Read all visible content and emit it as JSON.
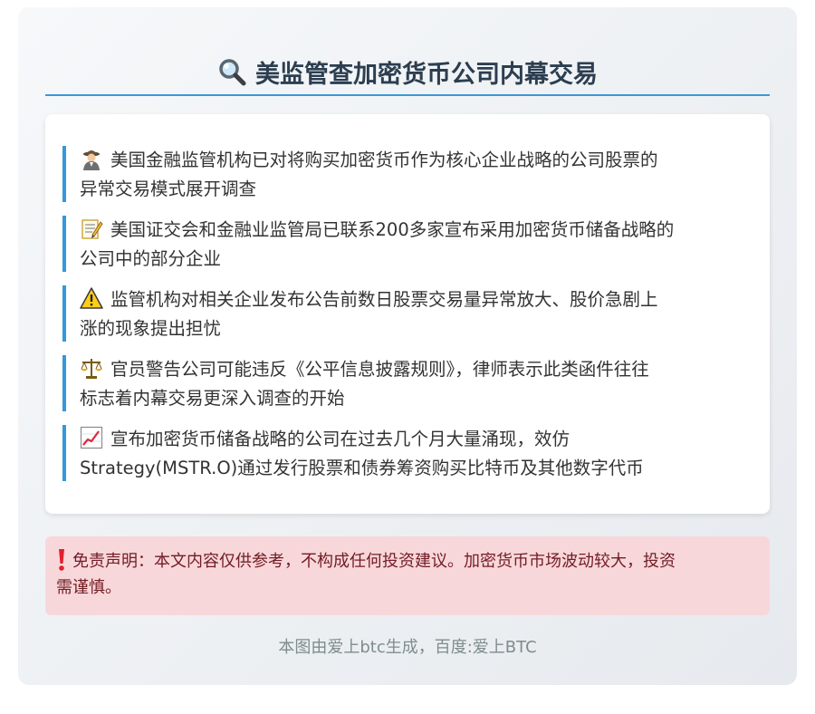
{
  "header": {
    "icon": "magnifying-glass-icon",
    "title": "美监管查加密货币公司内幕交易"
  },
  "items": [
    {
      "icon": "detective-icon",
      "line1": "美国金融监管机构已对将购买加密货币作为核心企业战略的公司股票的",
      "line2": "异常交易模式展开调查"
    },
    {
      "icon": "memo-icon",
      "line1": "美国证交会和金融业监管局已联系200多家宣布采用加密货币储备战略的",
      "line2": "公司中的部分企业"
    },
    {
      "icon": "warning-icon",
      "line1": "监管机构对相关企业发布公告前数日股票交易量异常放大、股价急剧上",
      "line2": "涨的现象提出担忧"
    },
    {
      "icon": "scales-icon",
      "line1": "官员警告公司可能违反《公平信息披露规则》，律师表示此类函件往往",
      "line2": "标志着内幕交易更深入调查的开始"
    },
    {
      "icon": "chart-increasing-icon",
      "line1": "宣布加密货币储备战略的公司在过去几个月大量涌现，效仿",
      "line2": "Strategy(MSTR.O)通过发行股票和债券筹资购买比特币及其他数字代币"
    }
  ],
  "disclaimer": {
    "icon": "exclamation-icon",
    "line1": "免责声明：本文内容仅供参考，不构成任何投资建议。加密货币市场波动较大，投资",
    "line2": "需谨慎。"
  },
  "footer": {
    "text": "本图由爱上btc生成，百度:爱上BTC"
  },
  "colors": {
    "accent": "#3498db",
    "title": "#2c3e50",
    "body_text": "#333333",
    "disclaimer_bg": "#f8d7da",
    "disclaimer_text": "#721c24",
    "footer_text": "#7f8c8d"
  }
}
